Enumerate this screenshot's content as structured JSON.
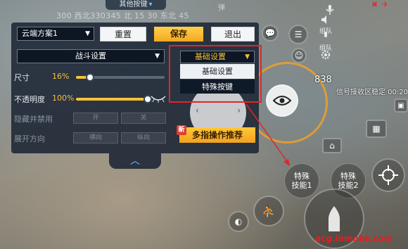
{
  "hud": {
    "top_tab_label": "其他按键",
    "compass_text": "300 西北330345 北  15  30 东北 45",
    "zhi_label": "弹",
    "net_indicator": "✖ ✈",
    "side_buttons": [
      {
        "label": "",
        "icon": "mic-icon"
      },
      {
        "label": "组队",
        "icon": "speaker-icon"
      },
      {
        "label": "组队",
        "icon": "emoji-icon"
      },
      {
        "label": "",
        "icon": "gear-icon"
      }
    ],
    "signal_number": "838",
    "signal_text": "信号接收区稳定  00:20",
    "skills": [
      {
        "label": "特殊\n技能1"
      },
      {
        "label": "特殊\n技能2"
      }
    ]
  },
  "panel": {
    "scheme_select": "云端方案1",
    "reset_label": "重置",
    "save_label": "保存",
    "exit_label": "退出",
    "category_select": "战斗设置",
    "size_label": "尺寸",
    "size_value": "16%",
    "size_fraction": 0.16,
    "opacity_label": "不透明度",
    "opacity_value": "100%",
    "opacity_fraction": 1.0,
    "hide_disable_label": "隐藏并禁用",
    "hide_on": "开",
    "hide_off": "关",
    "expand_label": "展开方向",
    "expand_h": "横向",
    "expand_v": "纵向",
    "recommend_badge": "新",
    "recommend_label": "多指操作推荐"
  },
  "dropdown": {
    "current": "基础设置",
    "options": [
      "基础设置",
      "特殊按键"
    ],
    "selected_index": 0
  },
  "watermark": "acg.inmoke.com",
  "colors": {
    "accent_orange": "#f5c03c",
    "panel_bg": "#1c2634",
    "highlight_red": "#e0262b"
  }
}
